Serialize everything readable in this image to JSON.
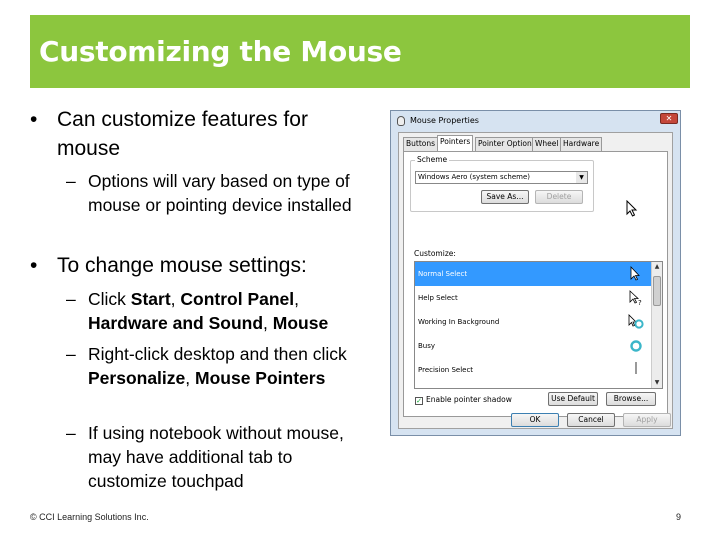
{
  "slide": {
    "title": "Customizing the Mouse",
    "footer_left": "© CCI Learning Solutions Inc.",
    "page_number": "9"
  },
  "content": {
    "bullet1": "Can customize features for mouse",
    "bullet1_sub1": "Options will vary based on type of mouse or pointing device installed",
    "bullet2": "To change mouse settings:",
    "bullet2_sub1_parts": [
      "Click ",
      "Start",
      ", ",
      "Control Panel",
      ", ",
      "Hardware and Sound",
      ", ",
      "Mouse"
    ],
    "bullet2_sub2_parts": [
      "Right-click desktop and then click ",
      "Personalize",
      ", ",
      "Mouse Pointers"
    ],
    "bullet2_sub3": "If using notebook without mouse, may have additional tab to customize touchpad"
  },
  "dialog": {
    "title": "Mouse Properties",
    "close_glyph": "✕",
    "tabs": [
      "Buttons",
      "Pointers",
      "Pointer Options",
      "Wheel",
      "Hardware"
    ],
    "active_tab": "Pointers",
    "scheme_label": "Scheme",
    "scheme_value": "Windows Aero (system scheme)",
    "save_as_button": "Save As...",
    "delete_button": "Delete",
    "customize_label": "Customize:",
    "pointer_items": [
      "Normal Select",
      "Help Select",
      "Working In Background",
      "Busy",
      "Precision Select"
    ],
    "selected_item": "Normal Select",
    "enable_shadow_label": "Enable pointer shadow",
    "use_default_button": "Use Default",
    "browse_button": "Browse...",
    "ok_button": "OK",
    "cancel_button": "Cancel",
    "apply_button": "Apply",
    "selection_color": "#3399ff"
  },
  "colors": {
    "title_bar": "#8cc63e",
    "title_text": "#ffffff"
  }
}
